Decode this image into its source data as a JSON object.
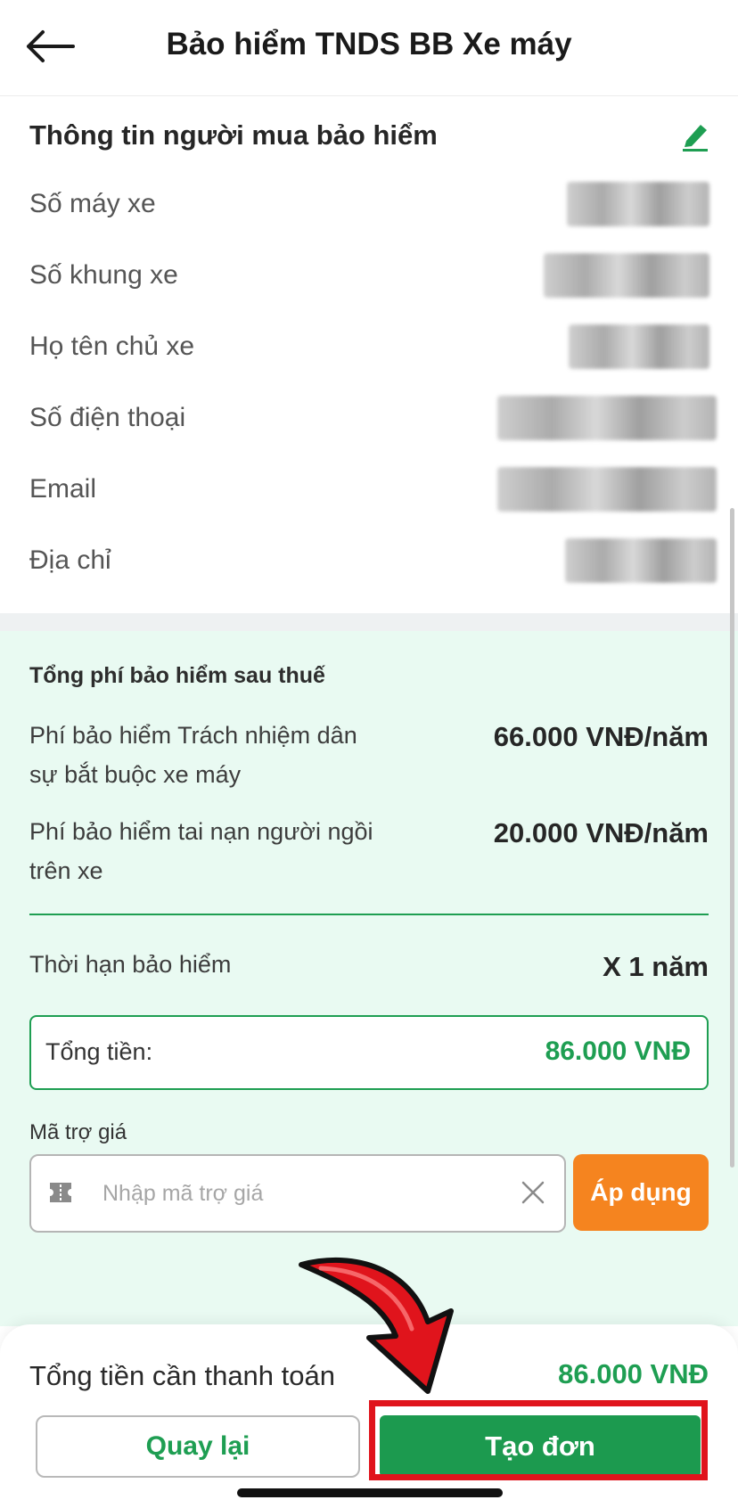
{
  "header": {
    "title": "Bảo hiểm TNDS BB Xe máy"
  },
  "buyer_info": {
    "section_title": "Thông tin người mua bảo hiểm",
    "rows": [
      {
        "label": "Số máy xe"
      },
      {
        "label": "Số khung xe"
      },
      {
        "label": "Họ tên chủ xe"
      },
      {
        "label": "Số điện thoại"
      },
      {
        "label": "Email"
      },
      {
        "label": "Địa chỉ"
      }
    ]
  },
  "fees": {
    "title": "Tổng phí bảo hiểm sau thuế",
    "items": [
      {
        "label": "Phí bảo hiểm Trách nhiệm dân sự bắt buộc xe máy",
        "value": "66.000 VNĐ/năm"
      },
      {
        "label": "Phí bảo hiểm tai nạn người ngồi trên xe",
        "value": "20.000 VNĐ/năm"
      }
    ],
    "term_label": "Thời hạn bảo hiểm",
    "term_value": "X 1 năm",
    "total_label": "Tổng tiền:",
    "total_value": "86.000 VNĐ"
  },
  "coupon": {
    "label": "Mã trợ giá",
    "placeholder": "Nhập mã trợ giá",
    "value": "",
    "apply_label": "Áp dụng"
  },
  "footer": {
    "pay_label": "Tổng tiền cần thanh toán",
    "pay_value": "86.000 VNĐ",
    "back_label": "Quay lại",
    "create_label": "Tạo đơn"
  },
  "colors": {
    "accent_green": "#1e9e52",
    "apply_orange": "#f5841f",
    "annotation_red": "#e0141c",
    "fees_background": "#e9faf2"
  },
  "icons": [
    "back-arrow-icon",
    "edit-pencil-icon",
    "ticket-icon",
    "clear-x-icon"
  ]
}
